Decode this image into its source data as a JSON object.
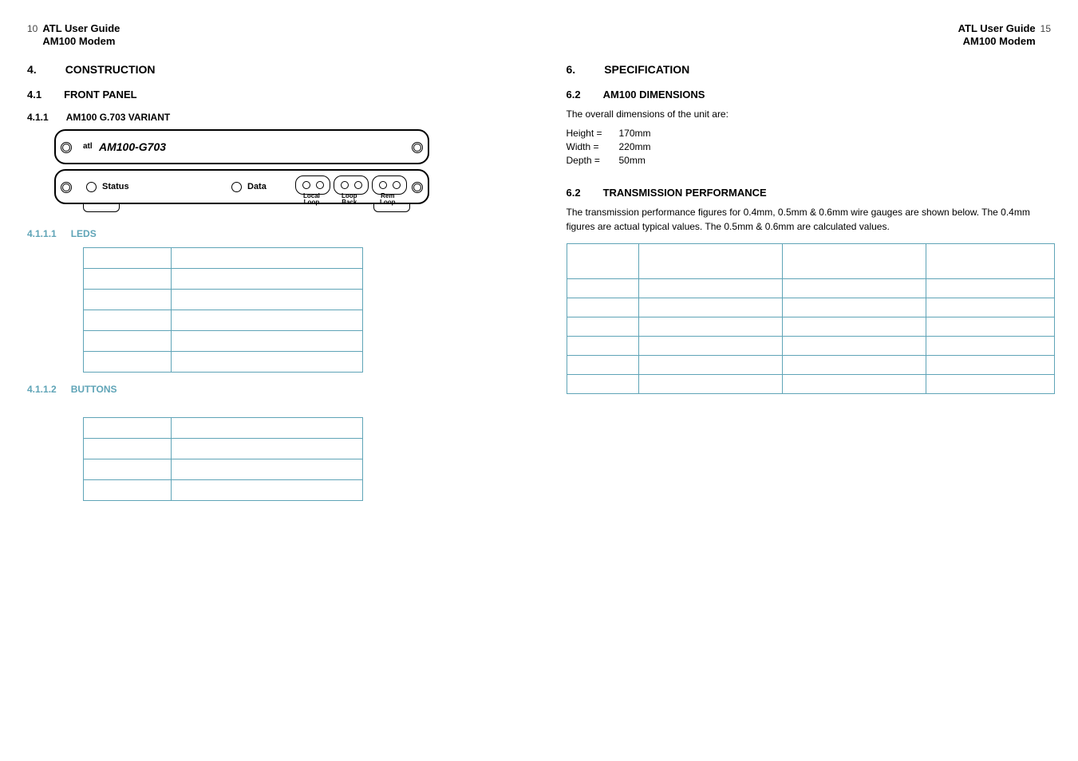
{
  "left": {
    "page_number": "10",
    "header_line1": "ATL User Guide",
    "header_line2": "AM100 Modem",
    "s4_num": "4.",
    "s4_title": "CONSTRUCTION",
    "s41_num": "4.1",
    "s41_title": "FRONT PANEL",
    "s411_num": "4.1.1",
    "s411_title": "AM100 G.703 VARIANT",
    "panel": {
      "logo_prefix": "atl",
      "logo_model": "AM100-G703",
      "status_label": "Status",
      "data_label": "Data",
      "localloop": "Local\nLoop",
      "loopback": "Loop\nBack",
      "remloop": "Rem\nLoop"
    },
    "s4111_num": "4.1.1.1",
    "s4111_title": "LEDS",
    "leds_rows": 6,
    "s4112_num": "4.1.1.2",
    "s4112_title": "BUTTONS",
    "buttons_rows": 4
  },
  "right": {
    "page_number": "15",
    "header_line1": "ATL User Guide",
    "header_line2": "AM100 Modem",
    "s6_num": "6.",
    "s6_title": "SPECIFICATION",
    "s62a_num": "6.2",
    "s62a_title": "AM100 DIMENSIONS",
    "dim_intro": "The overall dimensions of the unit are:",
    "height_k": "Height =",
    "height_v": "170mm",
    "width_k": "Width =",
    "width_v": "220mm",
    "depth_k": "Depth =",
    "depth_v": "50mm",
    "s62b_num": "6.2",
    "s62b_title": "TRANSMISSION PERFORMANCE",
    "perf_text": "The transmission performance figures for 0.4mm, 0.5mm & 0.6mm wire gauges are shown below. The 0.4mm figures are actual typical values. The 0.5mm & 0.6mm are calculated values.",
    "perf_rows": 7
  }
}
